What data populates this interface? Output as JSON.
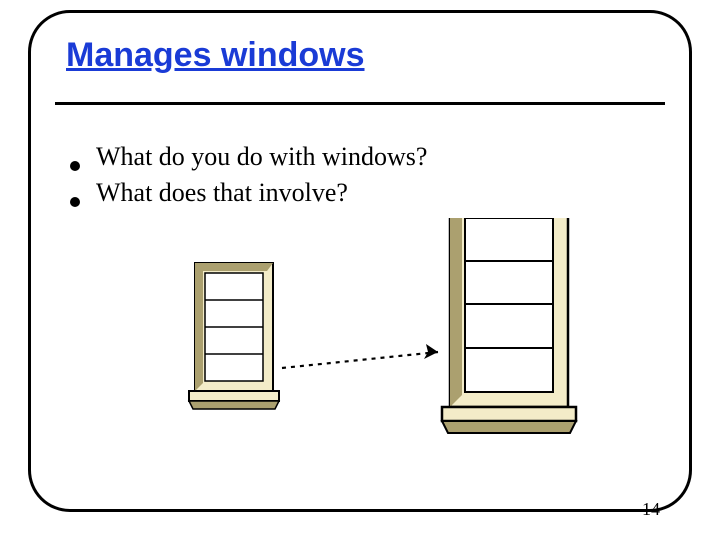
{
  "slide": {
    "title": "Manages windows",
    "bullets": [
      "What do you do with windows?",
      "What does that involve?"
    ],
    "page_number": "14"
  }
}
